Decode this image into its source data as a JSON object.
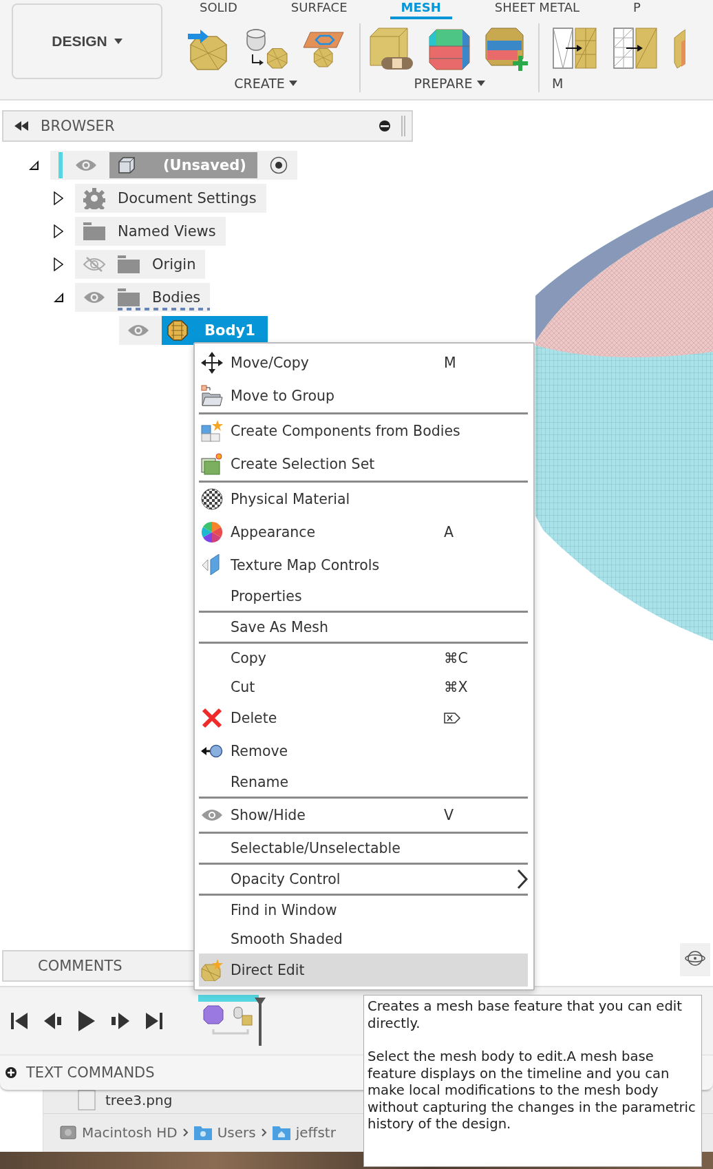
{
  "workspace": {
    "label": "DESIGN"
  },
  "toolbar_tabs": [
    {
      "label": "SOLID",
      "selected": false
    },
    {
      "label": "SURFACE",
      "selected": false
    },
    {
      "label": "MESH",
      "selected": true
    },
    {
      "label": "SHEET METAL",
      "selected": false
    },
    {
      "label": "P",
      "selected": false
    }
  ],
  "tool_groups": [
    {
      "label": "CREATE",
      "dropdown": true,
      "kind": "create"
    },
    {
      "label": "PREPARE",
      "dropdown": true,
      "kind": "prepare"
    },
    {
      "label": "M",
      "dropdown": false,
      "kind": "modify"
    }
  ],
  "browser": {
    "title": "BROWSER",
    "tree": [
      {
        "label": "(Unsaved)",
        "kind": "document",
        "expanded": true,
        "visible": true,
        "selected": false,
        "children": [
          {
            "label": "Document Settings",
            "kind": "settings",
            "expanded": false,
            "selected": false
          },
          {
            "label": "Named Views",
            "kind": "folder",
            "expanded": false,
            "selected": false
          },
          {
            "label": "Origin",
            "kind": "folder",
            "expanded": false,
            "visible": false,
            "selected": false
          },
          {
            "label": "Bodies",
            "kind": "folder",
            "expanded": true,
            "visible": true,
            "selected": false,
            "children": [
              {
                "label": "Body1",
                "kind": "body",
                "visible": true,
                "selected": true
              }
            ]
          }
        ]
      }
    ]
  },
  "context_menu": {
    "groups": [
      [
        {
          "label": "Move/Copy",
          "shortcut": "M",
          "kind": "move",
          "highlighted": false,
          "submenu": false
        },
        {
          "label": "Move to Group",
          "kind": "group",
          "highlighted": false,
          "submenu": false
        }
      ],
      [
        {
          "label": "Create Components from Bodies",
          "kind": "components",
          "highlighted": false,
          "submenu": false
        },
        {
          "label": "Create Selection Set",
          "kind": "selection-set",
          "highlighted": false,
          "submenu": false
        }
      ],
      [
        {
          "label": "Physical Material",
          "kind": "material",
          "highlighted": false,
          "submenu": false
        },
        {
          "label": "Appearance",
          "shortcut": "A",
          "kind": "appearance",
          "highlighted": false,
          "submenu": false
        },
        {
          "label": "Texture Map Controls",
          "kind": "texture",
          "highlighted": false,
          "submenu": false
        },
        {
          "label": "Properties",
          "kind": "plain",
          "highlighted": false,
          "submenu": false
        }
      ],
      [
        {
          "label": "Save As Mesh",
          "kind": "plain",
          "highlighted": false,
          "submenu": false
        }
      ],
      [
        {
          "label": "Copy",
          "shortcut": "⌘C",
          "kind": "plain",
          "highlighted": false,
          "submenu": false
        },
        {
          "label": "Cut",
          "shortcut": "⌘X",
          "kind": "plain",
          "highlighted": false,
          "submenu": false
        },
        {
          "label": "Delete",
          "kind": "delete",
          "highlighted": false,
          "submenu": false,
          "delete_key": true
        },
        {
          "label": "Remove",
          "kind": "remove",
          "highlighted": false,
          "submenu": false
        },
        {
          "label": "Rename",
          "kind": "plain",
          "highlighted": false,
          "submenu": false
        }
      ],
      [
        {
          "label": "Show/Hide",
          "shortcut": "V",
          "kind": "eye",
          "highlighted": false,
          "submenu": false
        }
      ],
      [
        {
          "label": "Selectable/Unselectable",
          "kind": "plain",
          "highlighted": false,
          "submenu": false
        }
      ],
      [
        {
          "label": "Opacity Control",
          "kind": "plain",
          "highlighted": false,
          "submenu": true
        }
      ],
      [
        {
          "label": "Find in Window",
          "kind": "plain",
          "highlighted": false,
          "submenu": false
        },
        {
          "label": "Smooth Shaded",
          "kind": "plain",
          "highlighted": false,
          "submenu": false
        },
        {
          "label": "Direct Edit",
          "kind": "direct-edit",
          "highlighted": true,
          "submenu": false
        }
      ]
    ]
  },
  "comments": {
    "title": "COMMENTS"
  },
  "text_commands": {
    "title": "TEXT COMMANDS"
  },
  "tooltip": {
    "paragraphs": [
      "Creates a mesh base feature that you can edit directly.",
      "Select the mesh body to edit.A mesh base feature displays on the timeline and you can make local modifications to the mesh body without capturing the changes in the parametric history of the design."
    ]
  },
  "finder": {
    "file": "tree3.png",
    "path": [
      {
        "label": "Macintosh HD",
        "kind": "disk"
      },
      {
        "label": "Users",
        "kind": "users"
      },
      {
        "label": "jeffstr",
        "kind": "home"
      }
    ]
  }
}
